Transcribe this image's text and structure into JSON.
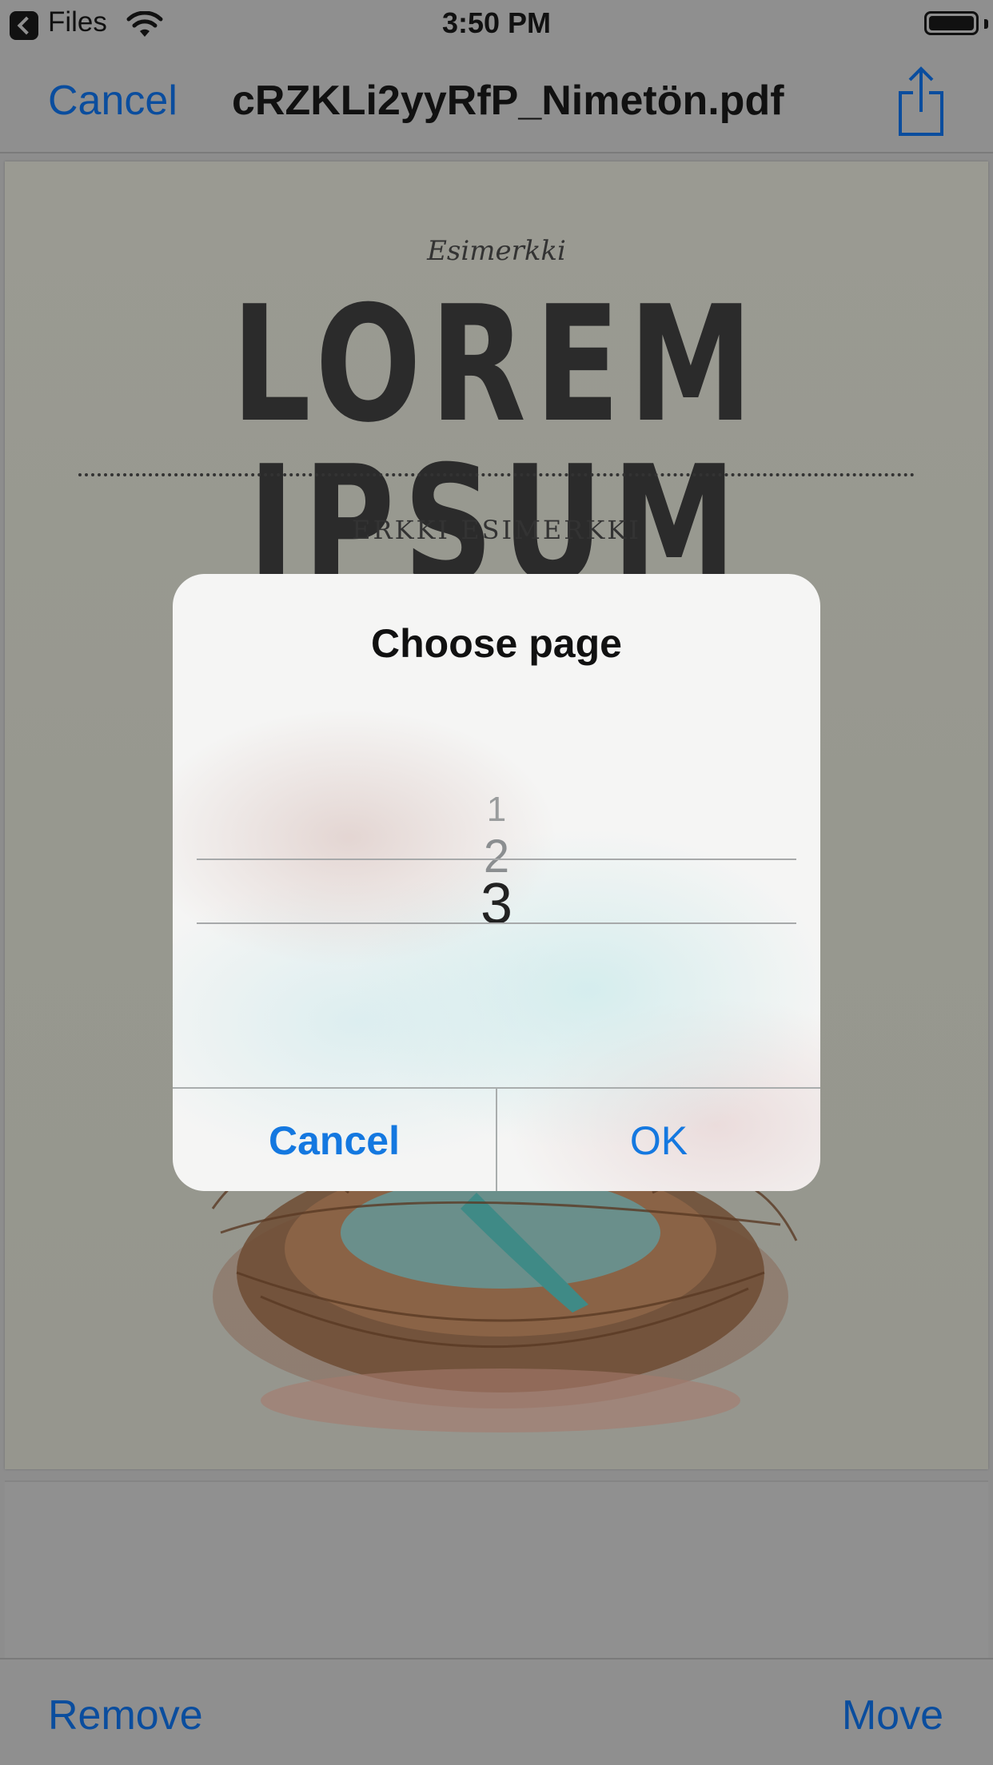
{
  "status_bar": {
    "back_app": "Files",
    "time": "3:50 PM"
  },
  "nav_bar": {
    "cancel_label": "Cancel",
    "title": "cRZKLi2yyRfP_Nimetön.pdf",
    "share_icon": "share-icon"
  },
  "document": {
    "kicker": "Esimerkki",
    "title": "LOREM IPSUM",
    "author": "ERKKI ESIMERKKI"
  },
  "dialog": {
    "title": "Choose page",
    "picker_values": [
      "1",
      "2",
      "3"
    ],
    "selected_page": "3",
    "cancel_label": "Cancel",
    "ok_label": "OK"
  },
  "toolbar": {
    "remove_label": "Remove",
    "move_label": "Move"
  },
  "colors": {
    "accent": "#1478e0",
    "dimmed_accent": "#0a4d9e"
  }
}
